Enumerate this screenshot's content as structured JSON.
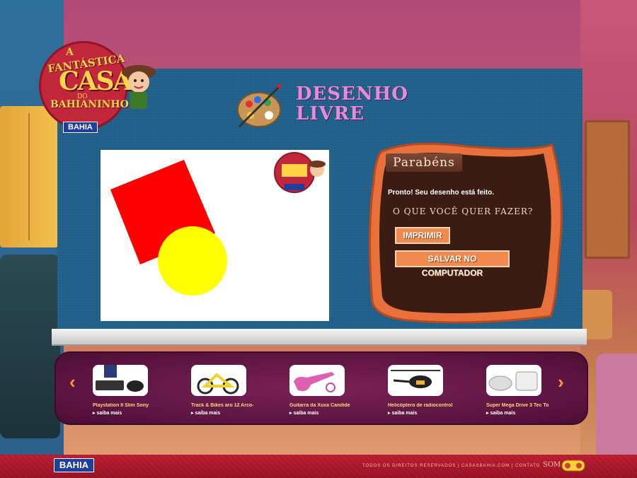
{
  "logo": {
    "line_a": "A",
    "line_fantastica": "FANTÁSTICA",
    "line_casa": "CASA",
    "line_do": "DO",
    "line_bahianinho": "BAHIANINHO",
    "brand": "BAHIA"
  },
  "header": {
    "title_line1": "DESENHO",
    "title_line2": "LIVRE"
  },
  "board": {
    "title": "Parabéns",
    "message": "Pronto! Seu desenho está feito.",
    "question": "O QUE VOCÊ QUER FAZER?",
    "print_label": "IMPRIMIR",
    "save_label": "SALVAR NO COMPUTADOR"
  },
  "carousel": {
    "prev_label": "‹",
    "next_label": "›",
    "more_label": "▸ saiba mais",
    "products": [
      {
        "name": "Playstation II Slim Sony",
        "icon": "game-console-icon"
      },
      {
        "name": "Track & Bikes aro 12 Arco-",
        "icon": "bicycle-icon"
      },
      {
        "name": "Guitarra da Xuxa Candide",
        "icon": "guitar-icon"
      },
      {
        "name": "Helicóptero de radiocontrol",
        "icon": "helicopter-icon"
      },
      {
        "name": "Super Mega Drive 3 Tec To",
        "icon": "video-game-icon"
      }
    ]
  },
  "footer": {
    "brand": "BAHIA",
    "rights": "TODOS OS DIREITOS RESERVADOS",
    "site": "CASASBAHIA.COM",
    "contact": "CONTATO",
    "sound": "SOM"
  },
  "colors": {
    "panel": "#1f5f88",
    "square": "#ff0000",
    "circle": "#ffff00",
    "button": "#f08a4e",
    "title": "#e98ad6"
  }
}
